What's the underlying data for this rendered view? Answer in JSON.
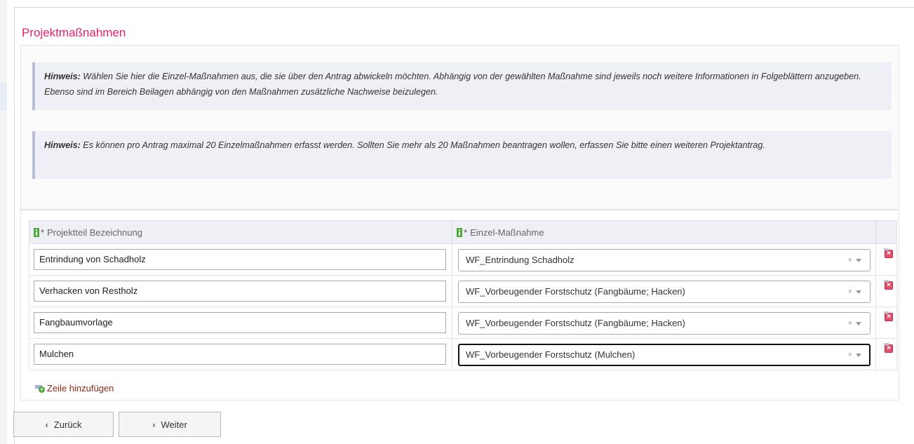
{
  "page": {
    "title": "Projektmaßnahmen"
  },
  "notes": [
    {
      "label": "Hinweis:",
      "text": "Wählen Sie hier die Einzel-Maßnahmen aus, die sie über den Antrag abwickeln möchten. Abhängig von der gewählten Maßnahme sind jeweils noch weitere Informationen in Folgeblättern anzugeben. Ebenso sind im Bereich Beilagen abhängig von den Maßnahmen zusätzliche Nachweise beizulegen."
    },
    {
      "label": "Hinweis:",
      "text": "Es können pro Antrag maximal 20 Einzelmaßnahmen erfasst werden. Sollten Sie mehr als 20 Maßnahmen beantragen wollen, erfassen Sie bitte einen weiteren Projektantrag."
    }
  ],
  "grid": {
    "columns": [
      {
        "label": "Projektteil Bezeichnung",
        "required_mark": "*",
        "icon": "info-icon"
      },
      {
        "label": "Einzel-Maßnahme",
        "required_mark": "*",
        "icon": "info-icon"
      }
    ],
    "rows": [
      {
        "bezeichnung": "Entrindung von Schadholz",
        "massnahme": "WF_Entrindung Schadholz"
      },
      {
        "bezeichnung": "Verhacken von Restholz",
        "massnahme": "WF_Vorbeugender Forstschutz (Fangbäume; Hacken)"
      },
      {
        "bezeichnung": "Fangbaumvorlage",
        "massnahme": "WF_Vorbeugender Forstschutz (Fangbäume; Hacken)"
      },
      {
        "bezeichnung": "Mulchen",
        "massnahme": "WF_Vorbeugender Forstschutz (Mulchen)"
      }
    ],
    "clear_symbol": "×",
    "add_row_label": "Zeile hinzufügen"
  },
  "nav": {
    "back_label": "Zurück",
    "next_label": "Weiter"
  },
  "colors": {
    "title": "#e8206e",
    "note_background": "#eef0f6",
    "link": "#8a2a14",
    "info_icon": "#4bab3b",
    "delete_icon": "#e34f6b"
  }
}
